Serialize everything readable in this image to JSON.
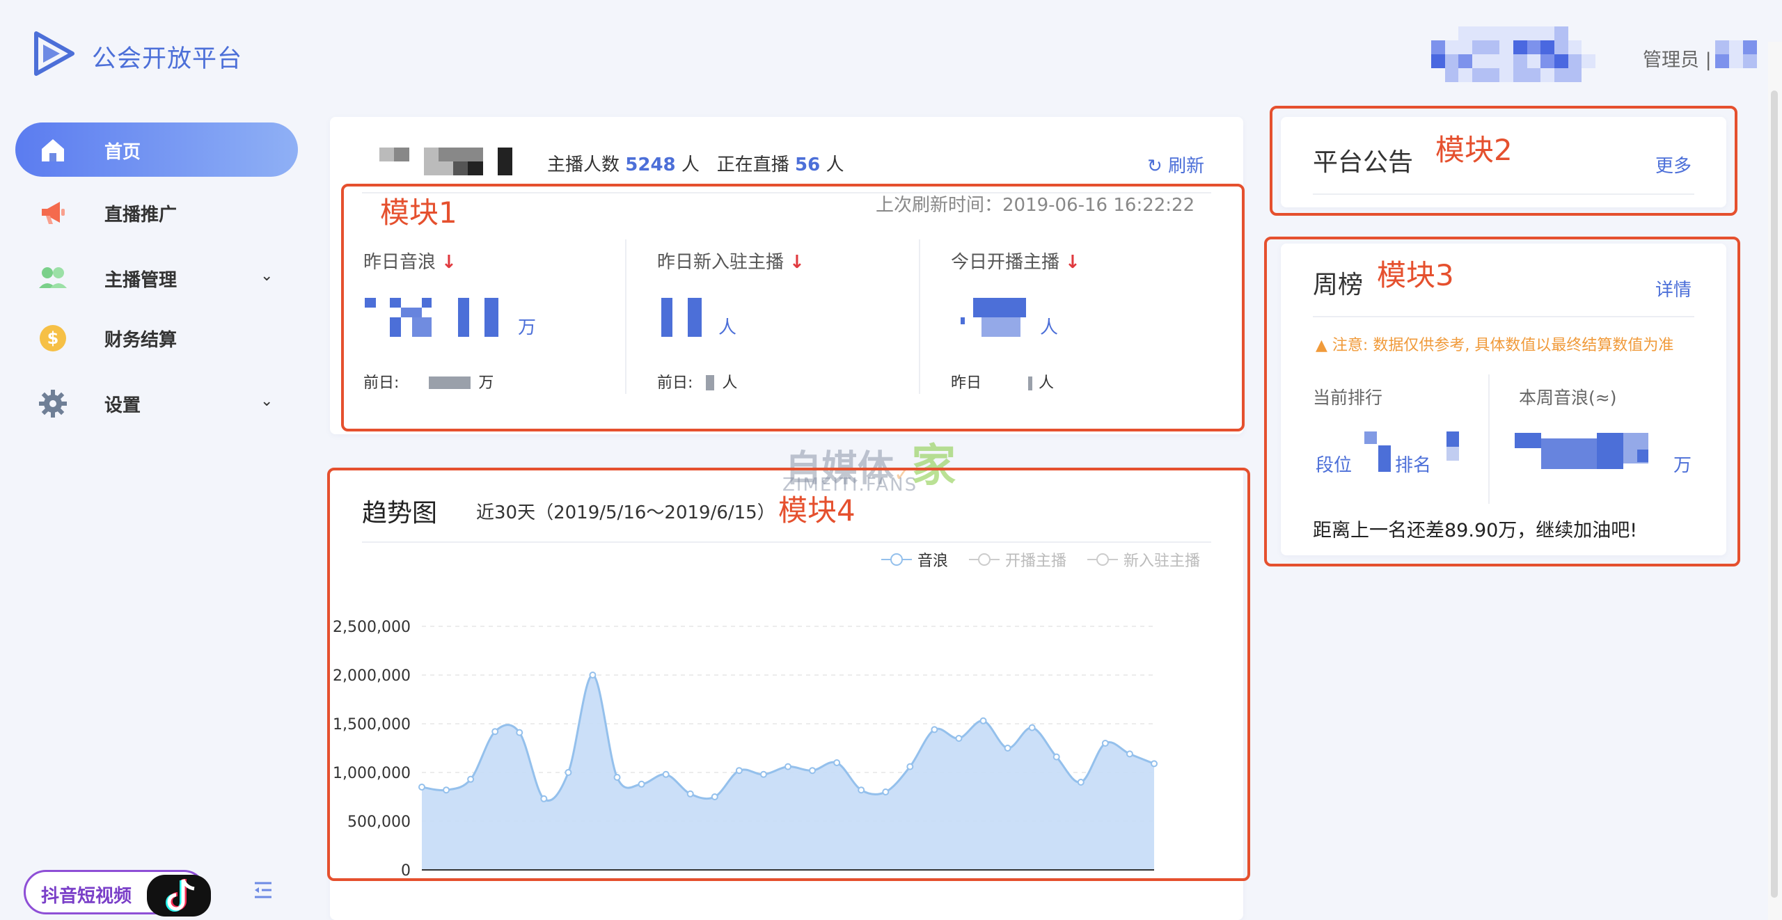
{
  "app": {
    "title": "公会开放平台"
  },
  "header": {
    "admin_label": "管理员 |"
  },
  "sidebar": {
    "items": [
      {
        "label": "首页",
        "icon": "home-icon"
      },
      {
        "label": "直播推广",
        "icon": "megaphone-icon"
      },
      {
        "label": "主播管理",
        "icon": "users-icon"
      },
      {
        "label": "财务结算",
        "icon": "dollar-coin-icon"
      },
      {
        "label": "设置",
        "icon": "gear-icon"
      }
    ],
    "tiktok_label": "抖音短视频"
  },
  "card1": {
    "anchors_label": "主播人数",
    "anchors_count": "5248",
    "unit_person": "人",
    "live_label": "正在直播",
    "live_count": "56",
    "refresh_label": "刷新",
    "last_refresh": "上次刷新时间：2019-06-16 16:22:22",
    "stats": [
      {
        "label": "昨日音浪",
        "unit": "万",
        "prev_label": "前日:",
        "prev_unit": "万"
      },
      {
        "label": "昨日新入驻主播",
        "unit": "人",
        "prev_label": "前日:",
        "prev_unit": "人"
      },
      {
        "label": "今日开播主播",
        "unit": "人",
        "prev_label": "昨日",
        "prev_unit": "人"
      }
    ]
  },
  "card2": {
    "title": "平台公告",
    "more": "更多"
  },
  "card3": {
    "title": "周榜",
    "details": "详情",
    "warning": "注意: 数据仅供参考, 具体数值以最终结算数值为准",
    "rank_label": "当前排行",
    "sound_label": "本周音浪(≈)",
    "segment": "段位",
    "rank": "排名",
    "unit": "万",
    "footer": "距离上一名还差89.90万，继续加油吧!"
  },
  "card4": {
    "title": "趋势图",
    "range": "近30天（2019/5/16～2019/6/15）",
    "legend": [
      "音浪",
      "开播主播",
      "新入驻主播"
    ]
  },
  "annotations": [
    "模块1",
    "模块2",
    "模块3",
    "模块4"
  ],
  "watermark": {
    "line1": "自媒体",
    "home": "家",
    "line2": "ZIMEITI.FANS"
  },
  "colors": {
    "accent": "#4c6fd8",
    "annotation": "#e5502e",
    "warning": "#f09a3a",
    "down": "#e0393e",
    "area": "#c5dcf7",
    "line": "#94c0ec"
  },
  "chart_data": {
    "type": "area",
    "x": [
      1,
      2,
      3,
      4,
      5,
      6,
      7,
      8,
      9,
      10,
      11,
      12,
      13,
      14,
      15,
      16,
      17,
      18,
      19,
      20,
      21,
      22,
      23,
      24,
      25,
      26,
      27,
      28,
      29,
      30
    ],
    "series": [
      {
        "name": "音浪",
        "values": [
          850000,
          820000,
          930000,
          1420000,
          1410000,
          730000,
          1000000,
          2000000,
          950000,
          880000,
          980000,
          780000,
          750000,
          1020000,
          980000,
          1060000,
          1020000,
          1100000,
          820000,
          800000,
          1060000,
          1440000,
          1350000,
          1530000,
          1250000,
          1460000,
          1160000,
          900000,
          1300000,
          1190000,
          1090000
        ]
      }
    ],
    "yticks": [
      "2,500,000",
      "2,000,000",
      "1,500,000",
      "1,000,000",
      "500,000",
      "0"
    ],
    "ylim": [
      0,
      2500000
    ]
  }
}
